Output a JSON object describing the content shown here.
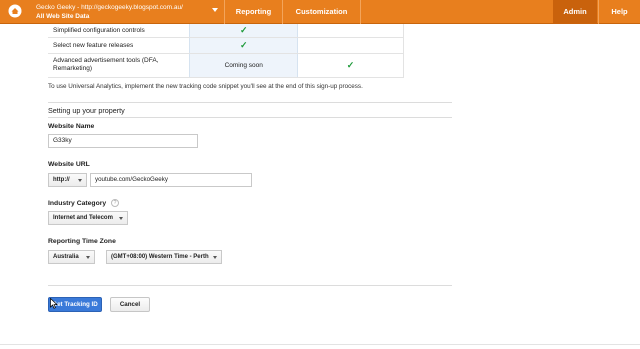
{
  "topbar": {
    "account_line1": "Gecko Geeky - http://geckogeeky.blogspot.com.au/",
    "account_line2": "All Web Site Data",
    "nav": [
      "Reporting",
      "Customization",
      "Admin",
      "Help"
    ],
    "accent": "#e87f1e"
  },
  "features": [
    {
      "name": "Simplified configuration controls",
      "classic": "✓",
      "universal": ""
    },
    {
      "name": "Select new feature releases",
      "classic": "✓",
      "universal": ""
    },
    {
      "name": "Advanced advertisement tools (DFA, Remarketing)",
      "classic": "Coming soon",
      "universal": "✓"
    }
  ],
  "note": "To use Universal Analytics, implement the new tracking code snippet you'll see at the end of this sign-up process.",
  "property": {
    "section_title": "Setting up your property",
    "website_name_label": "Website Name",
    "website_name_value": "G33ky",
    "website_url_label": "Website URL",
    "protocol": "http://",
    "website_url_value": "youtube.com/GeckoGeeky",
    "industry_label": "Industry Category",
    "industry_value": "Internet and Telecom",
    "help_glyph": "?",
    "timezone_label": "Reporting Time Zone",
    "country_value": "Australia",
    "timezone_value": "(GMT+08:00) Western Time - Perth"
  },
  "actions": {
    "get_tracking_id": "Get Tracking ID",
    "cancel": "Cancel"
  }
}
